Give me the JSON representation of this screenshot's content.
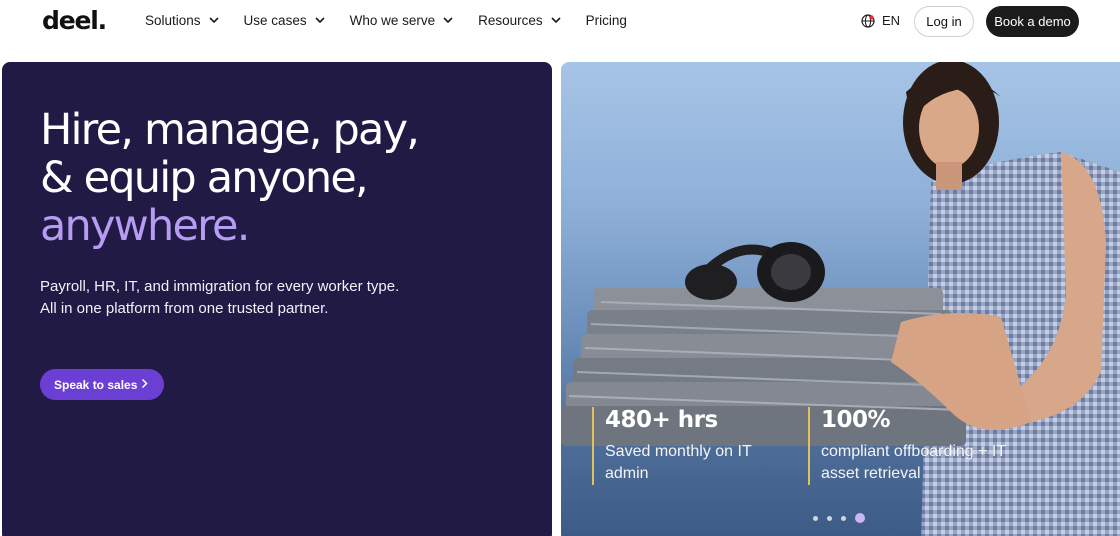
{
  "nav": {
    "logo": "deel.",
    "menu": [
      {
        "label": "Solutions",
        "dropdown": true
      },
      {
        "label": "Use cases",
        "dropdown": true
      },
      {
        "label": "Who we serve",
        "dropdown": true
      },
      {
        "label": "Resources",
        "dropdown": true
      },
      {
        "label": "Pricing",
        "dropdown": false
      }
    ],
    "language": "EN",
    "login_label": "Log in",
    "demo_label": "Book a demo"
  },
  "hero": {
    "headline_line1": "Hire, manage, pay,",
    "headline_line2": "& equip anyone,",
    "headline_accent": "anywhere.",
    "subtext_line1": "Payroll, HR, IT, and immigration for every worker type.",
    "subtext_line2": "All in one platform from one trusted partner.",
    "cta_label": "Speak to sales"
  },
  "stats": [
    {
      "value": "480+ hrs",
      "label_line1": "Saved monthly on IT",
      "label_line2": "admin"
    },
    {
      "value": "100%",
      "label_line1": "compliant offboarding + IT",
      "label_line2": "asset retrieval"
    }
  ],
  "carousel": {
    "total": 4,
    "active_index": 3
  },
  "colors": {
    "hero_bg": "#211a45",
    "accent_purple": "#b79cf3",
    "cta_bg": "#6c3fd4",
    "stat_bar": "#e3c15a",
    "demo_button_bg": "#1b1b1b"
  },
  "icons": {
    "menu_dropdown": "chevron-down-icon",
    "language": "globe-icon",
    "cta": "chevron-right-icon"
  }
}
